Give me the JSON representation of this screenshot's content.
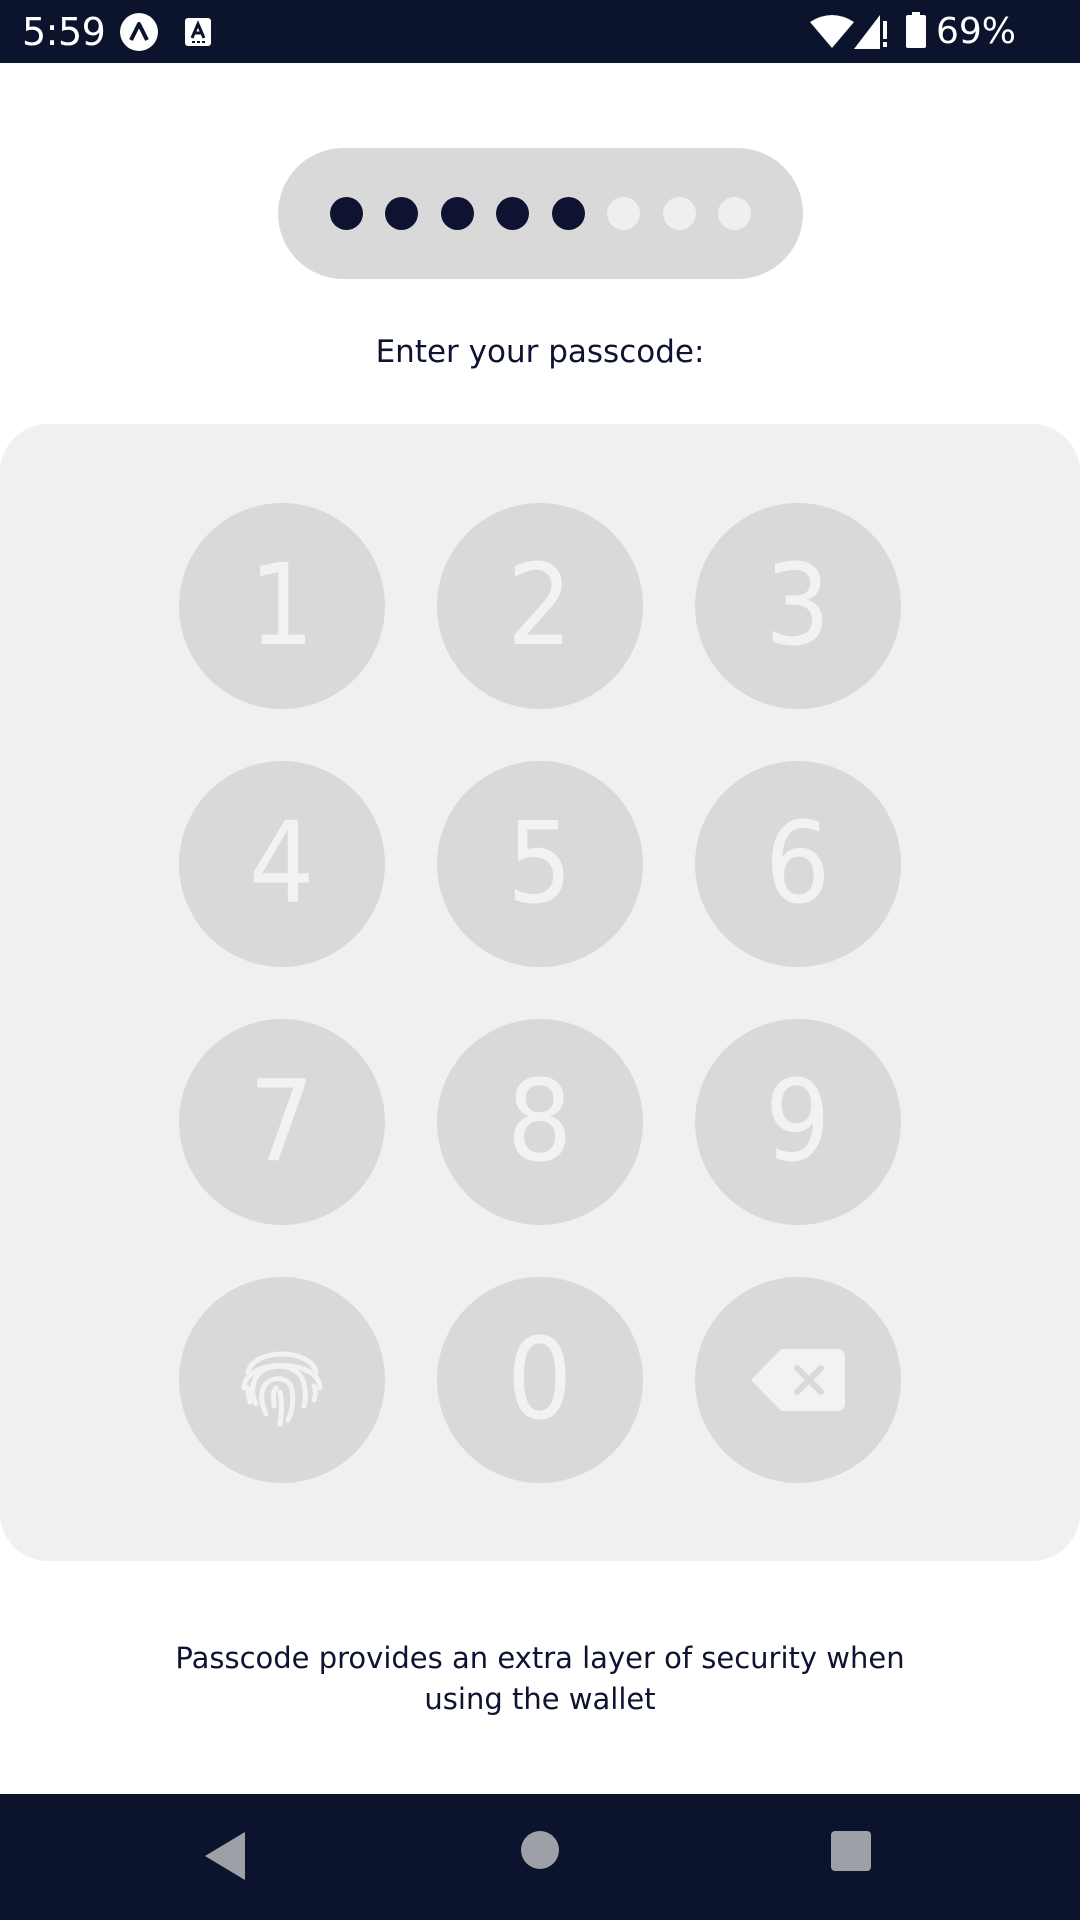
{
  "status_bar": {
    "time": "5:59",
    "battery": "69%",
    "icons": [
      "app-launcher-icon",
      "text-input-icon",
      "wifi-icon",
      "cell-signal-icon",
      "battery-icon"
    ]
  },
  "passcode": {
    "total_digits": 8,
    "entered_digits": 5,
    "prompt": "Enter your passcode:"
  },
  "keypad": {
    "keys": [
      "1",
      "2",
      "3",
      "4",
      "5",
      "6",
      "7",
      "8",
      "9",
      "0"
    ],
    "special_keys": [
      "fingerprint-icon",
      "backspace-icon"
    ]
  },
  "footnote": "Passcode provides an extra layer of security when using the wallet",
  "nav_bar": {
    "icons": [
      "back-icon",
      "home-icon",
      "recents-icon"
    ]
  },
  "colors": {
    "dark": "#0c132c",
    "dot_filled": "#0d1330",
    "dot_empty": "#efefef",
    "key_bg": "#d9d9d9",
    "panel_bg": "#f0f0f0"
  }
}
